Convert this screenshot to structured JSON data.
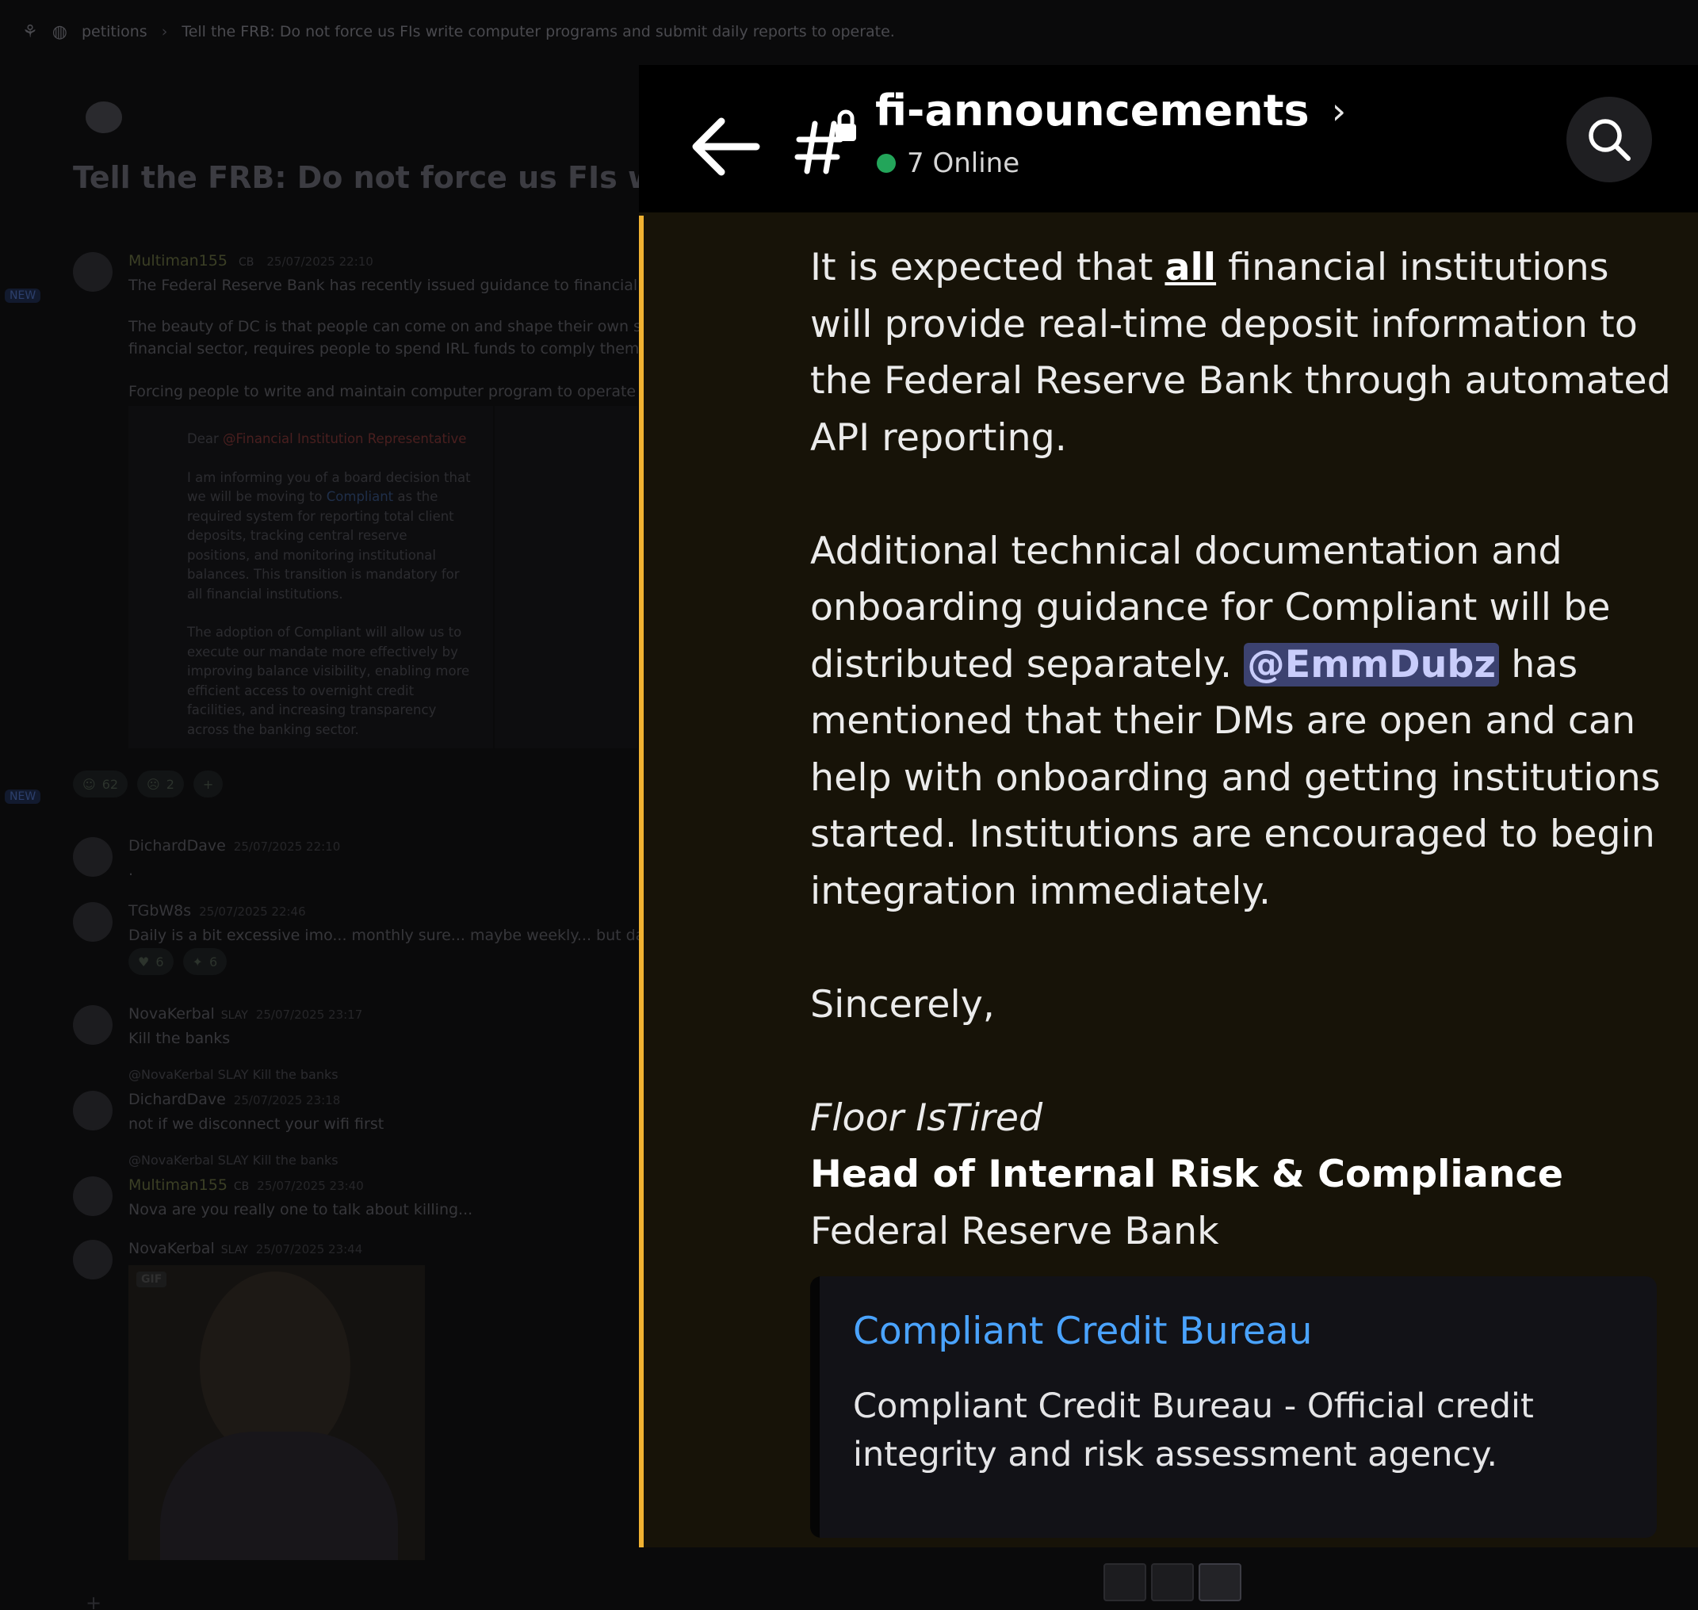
{
  "breadcrumb": {
    "channel": "petitions",
    "thread": "Tell the FRB: Do not force us FIs write computer programs and submit daily reports to operate."
  },
  "thread_title": "Tell the FRB: Do not force us FIs write co",
  "side_badges": [
    "NEW",
    "NEW"
  ],
  "messages": [
    {
      "name": "Multiman155",
      "tag": "CB",
      "timestamp": "25/07/2025 22:10",
      "body": "The Federal Reserve Bank has recently issued guidance to financial institut"
    },
    {
      "body2": "The beauty of DC is that people can come on and shape their own stories. T",
      "body3": "financial sector, requires people to spend IRL funds to comply themselves, a",
      "body4": "Forcing people to write and maintain computer program to operate their b"
    }
  ],
  "embed_doc": {
    "greeting_prefix": "Dear ",
    "greeting_role": "@Financial Institution Representative",
    "para1_a": "I am informing you of a board decision that we will be moving to ",
    "para1_link": "Compliant",
    "para1_b": " as the required system for reporting total client deposits, tracking central reserve positions, and monitoring institutional balances. This transition is mandatory for all financial institutions.",
    "para2": "The adoption of Compliant will allow us to execute our mandate more effectively by improving balance visibility, enabling more efficient access to overnight credit facilities, and increasing transparency across the banking sector."
  },
  "reactions": [
    {
      "icon": "☺",
      "count": "62"
    },
    {
      "icon": "☹",
      "count": "2"
    },
    {
      "icon": "+",
      "count": ""
    }
  ],
  "replies": [
    {
      "name": "DichardDave",
      "timestamp": "25/07/2025 22:10",
      "body": "."
    },
    {
      "name": "TGbW8s",
      "timestamp": "25/07/2025 22:46",
      "body": "Daily is a bit excessive imo... monthly sure... maybe weekly... but daily is... du",
      "r1": "6",
      "r2": "6"
    },
    {
      "name": "NovaKerbal",
      "badge": "SLAY",
      "timestamp": "25/07/2025 23:17",
      "body": "Kill the banks"
    },
    {
      "quote": "@NovaKerbal SLAY Kill the banks",
      "name": "DichardDave",
      "timestamp": "25/07/2025 23:18",
      "body": "not if we disconnect your wifi first"
    },
    {
      "quote": "@NovaKerbal SLAY Kill the banks",
      "name": "Multiman155",
      "tag": "CB",
      "timestamp": "25/07/2025 23:40",
      "body": "Nova are you really one to talk about killing..."
    },
    {
      "name": "NovaKerbal",
      "badge": "SLAY",
      "timestamp": "25/07/2025 23:44",
      "gif": "GIF"
    }
  ],
  "panel": {
    "channel_name": "fi-announcements",
    "online_text": "7 Online",
    "p1_before": "It is expected that ",
    "p1_bold": "all",
    "p1_after": " financial institutions will provide real-time deposit information to the Federal Reserve Bank through automated API reporting.",
    "p2_before": "Additional technical documentation and onboarding guidance for Compliant will be distributed separately. ",
    "p2_mention": "@EmmDubz",
    "p2_after": " has mentioned that their DMs are open and can help with onboarding and getting institutions started. Institutions are encouraged to begin integration immediately.",
    "closing": "Sincerely,",
    "sig_name": "Floor IsTired",
    "sig_title": "Head of Internal Risk & Compliance",
    "sig_org": "Federal Reserve Bank",
    "embed_title": "Compliant Credit Bureau",
    "embed_desc": "Compliant Credit Bureau - Official credit integrity and risk assessment agency."
  },
  "colors": {
    "accent_bar": "#f0b232",
    "online_dot": "#23a55a",
    "link": "#4aa3ff",
    "mention_bg": "#3c4270"
  }
}
